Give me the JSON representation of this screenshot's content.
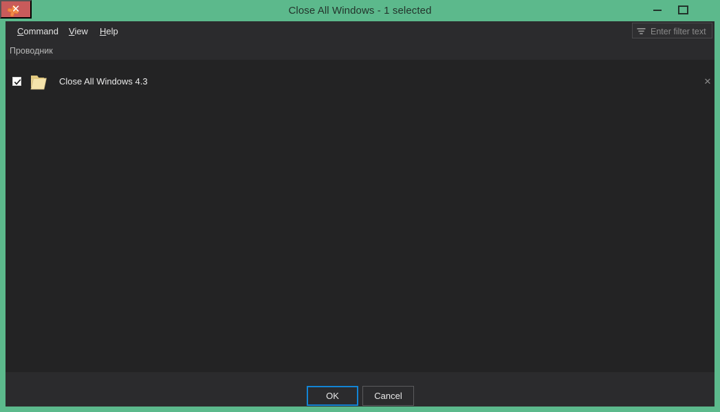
{
  "window": {
    "title": "Close All Windows - 1 selected",
    "app_icon": "orange-x-icon",
    "frame_color": "#5cb98c",
    "client_bg": "#232324",
    "panel_bg": "#2b2b2d",
    "controls": {
      "minimize_label": "Minimize",
      "maximize_label": "Maximize",
      "close_label": "✕",
      "close_bg": "#c85b5b"
    }
  },
  "menu": {
    "items": [
      {
        "label": "Command",
        "mnemonic": "C",
        "rest": "ommand"
      },
      {
        "label": "View",
        "mnemonic": "V",
        "rest": "iew"
      },
      {
        "label": "Help",
        "mnemonic": "H",
        "rest": "elp"
      }
    ]
  },
  "filter": {
    "placeholder": "Enter filter text",
    "value": "",
    "icon": "filter-funnel-icon"
  },
  "list": {
    "group_header": "Проводник",
    "rows": [
      {
        "label": "Close All Windows 4.3",
        "checked": true,
        "icon": "folder-icon",
        "remove_label": "✕"
      }
    ]
  },
  "footer": {
    "ok_label": "OK",
    "cancel_label": "Cancel",
    "focus_color": "#1285d6"
  }
}
